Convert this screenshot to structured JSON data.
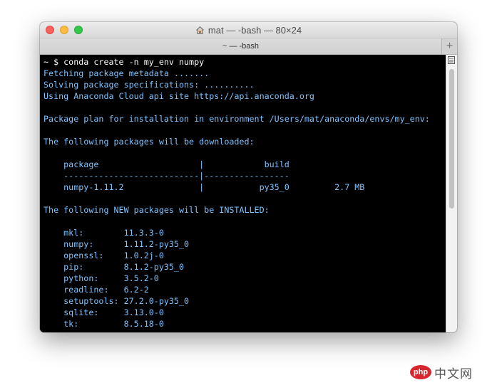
{
  "window": {
    "title": "mat — -bash — 80×24",
    "tab_label": "~ — -bash",
    "new_tab_symbol": "+"
  },
  "terminal": {
    "text_color": "#7dc3ff",
    "background": "#000000",
    "lines": [
      {
        "row": 0,
        "text": "~ $ conda create -n my_env numpy",
        "color": "#ffffff"
      },
      {
        "row": 1,
        "text": "Fetching package metadata ......."
      },
      {
        "row": 2,
        "text": "Solving package specifications: .........."
      },
      {
        "row": 3,
        "text": "Using Anaconda Cloud api site https://api.anaconda.org"
      },
      {
        "row": 5,
        "text": "Package plan for installation in environment /Users/mat/anaconda/envs/my_env:"
      },
      {
        "row": 7,
        "text": "The following packages will be downloaded:"
      },
      {
        "row": 9,
        "text": "    package                    |            build"
      },
      {
        "row": 10,
        "text": "    ---------------------------|-----------------"
      },
      {
        "row": 11,
        "text": "    numpy-1.11.2               |           py35_0         2.7 MB"
      },
      {
        "row": 13,
        "text": "The following NEW packages will be INSTALLED:"
      },
      {
        "row": 15,
        "text": "    mkl:        11.3.3-0"
      },
      {
        "row": 16,
        "text": "    numpy:      1.11.2-py35_0"
      },
      {
        "row": 17,
        "text": "    openssl:    1.0.2j-0"
      },
      {
        "row": 18,
        "text": "    pip:        8.1.2-py35_0"
      },
      {
        "row": 19,
        "text": "    python:     3.5.2-0"
      },
      {
        "row": 20,
        "text": "    readline:   6.2-2"
      },
      {
        "row": 21,
        "text": "    setuptools: 27.2.0-py35_0"
      },
      {
        "row": 22,
        "text": "    sqlite:     3.13.0-0"
      },
      {
        "row": 23,
        "text": "    tk:         8.5.18-0"
      }
    ]
  },
  "watermark": {
    "badge": "php",
    "text": "中文网"
  }
}
